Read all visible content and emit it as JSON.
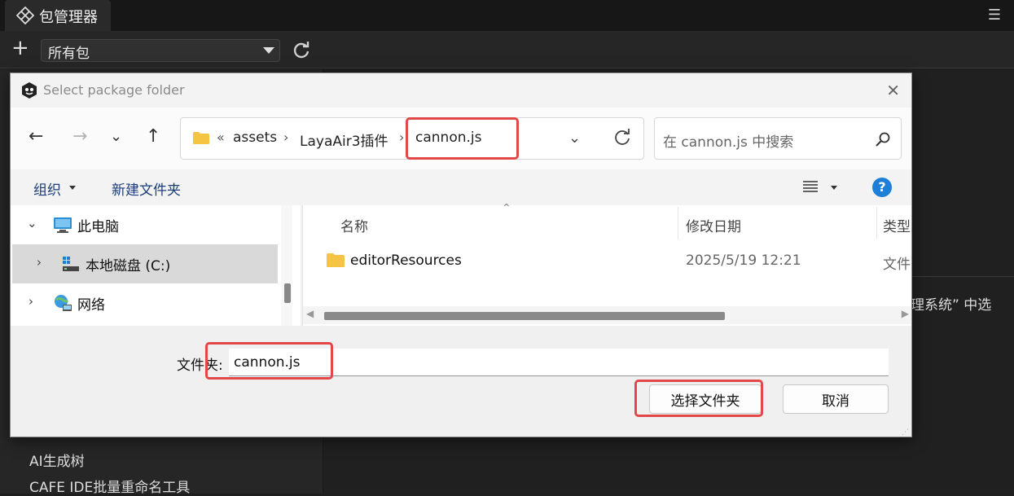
{
  "editor": {
    "tab_title": "包管理器",
    "package_filter": "所有包",
    "right_panel_text": "理系统” 中选",
    "list_items": [
      "AI生成树",
      "CAFE IDE批量重命名工具"
    ]
  },
  "dialog": {
    "title": "Select package folder",
    "address": {
      "overflow": "«",
      "parts": [
        "assets",
        "LayaAir3插件",
        "cannon.js"
      ]
    },
    "search_placeholder": "在 cannon.js 中搜索",
    "commands": {
      "organize": "组织",
      "new_folder": "新建文件夹"
    },
    "tree": [
      {
        "label": "此电脑"
      },
      {
        "label": "本地磁盘 (C:)"
      },
      {
        "label": "网络"
      }
    ],
    "columns": {
      "name": "名称",
      "modified": "修改日期",
      "type": "类型"
    },
    "files": [
      {
        "name": "editorResources",
        "modified": "2025/5/19 12:21",
        "type": "文件"
      }
    ],
    "folder_label": "文件夹:",
    "folder_value": "cannon.js",
    "buttons": {
      "select": "选择文件夹",
      "cancel": "取消"
    }
  },
  "colors": {
    "highlight": "#e34747",
    "accent": "#1e7fd8",
    "folder": "#f6c443"
  }
}
